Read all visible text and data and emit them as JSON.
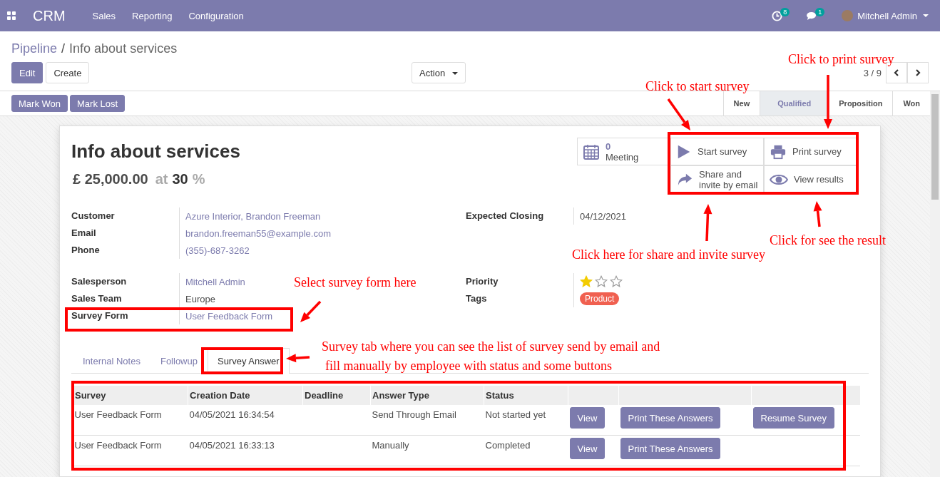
{
  "navbar": {
    "app": "CRM",
    "menu": [
      "Sales",
      "Reporting",
      "Configuration"
    ],
    "activity_count": "8",
    "message_count": "1",
    "user": "Mitchell Admin"
  },
  "breadcrumb": {
    "parent": "Pipeline",
    "separator": "/",
    "current": "Info about services"
  },
  "actions": {
    "edit": "Edit",
    "create": "Create",
    "action": "Action",
    "pager": "3 / 9"
  },
  "status_buttons": [
    "Mark Won",
    "Mark Lost"
  ],
  "stages": [
    {
      "label": "New",
      "selected": false
    },
    {
      "label": "Qualified",
      "selected": true
    },
    {
      "label": "Proposition",
      "selected": false
    },
    {
      "label": "Won",
      "selected": false
    }
  ],
  "record": {
    "title": "Info about services",
    "amount": "£ 25,000.00",
    "at": "at",
    "probability": "30",
    "percent": "%"
  },
  "smart_buttons": [
    {
      "kind": "meeting",
      "count": "0",
      "label": "Meeting"
    },
    {
      "kind": "start",
      "label": "Start survey"
    },
    {
      "kind": "print",
      "label": "Print survey"
    },
    {
      "kind": "share",
      "label": "Share and invite by email"
    },
    {
      "kind": "results",
      "label": "View results"
    }
  ],
  "fields_left": [
    {
      "label": "Customer",
      "value": "Azure Interior, Brandon Freeman",
      "link": true
    },
    {
      "label": "Email",
      "value": "brandon.freeman55@example.com",
      "link": true
    },
    {
      "label": "Phone",
      "value": "(355)-687-3262",
      "link": true
    },
    {
      "label": "Salesperson",
      "value": "Mitchell Admin",
      "link": true
    },
    {
      "label": "Sales Team",
      "value": "Europe",
      "link": false
    },
    {
      "label": "Survey Form",
      "value": "User Feedback Form",
      "link": true
    }
  ],
  "fields_right": [
    {
      "kind": "text",
      "label": "Expected Closing",
      "value": "04/12/2021"
    },
    {
      "kind": "stars",
      "label": "Priority",
      "stars": 1
    },
    {
      "kind": "tag",
      "label": "Tags",
      "value": "Product",
      "color": "#f06050"
    }
  ],
  "tabs": [
    {
      "label": "Internal Notes",
      "selected": false
    },
    {
      "label": "Followup",
      "selected": false
    },
    {
      "label": "Survey Answer",
      "selected": true
    }
  ],
  "table": {
    "columns": [
      "Survey",
      "Creation Date",
      "Deadline",
      "Answer Type",
      "Status"
    ],
    "rows": [
      {
        "cells": [
          "User Feedback Form",
          "04/05/2021 16:34:54",
          "",
          "Send Through Email",
          "Not started yet"
        ],
        "buttons": [
          "View",
          "Print These Answers",
          "Resume Survey"
        ]
      },
      {
        "cells": [
          "User Feedback Form",
          "04/05/2021 16:33:13",
          "",
          "Manually",
          "Completed"
        ],
        "buttons": [
          "View",
          "Print These Answers"
        ]
      }
    ]
  },
  "annotations": [
    {
      "lines": [
        "Click to print survey"
      ]
    },
    {
      "lines": [
        "Click to start survey"
      ]
    },
    {
      "lines": [
        "Click here for share and invite survey"
      ]
    },
    {
      "lines": [
        "Click for see the result"
      ]
    },
    {
      "lines": [
        "Select survey form here"
      ]
    },
    {
      "lines": [
        "Survey tab where you can see the list of survey send by email and",
        "fill manually by employee with status and some buttons"
      ]
    }
  ]
}
